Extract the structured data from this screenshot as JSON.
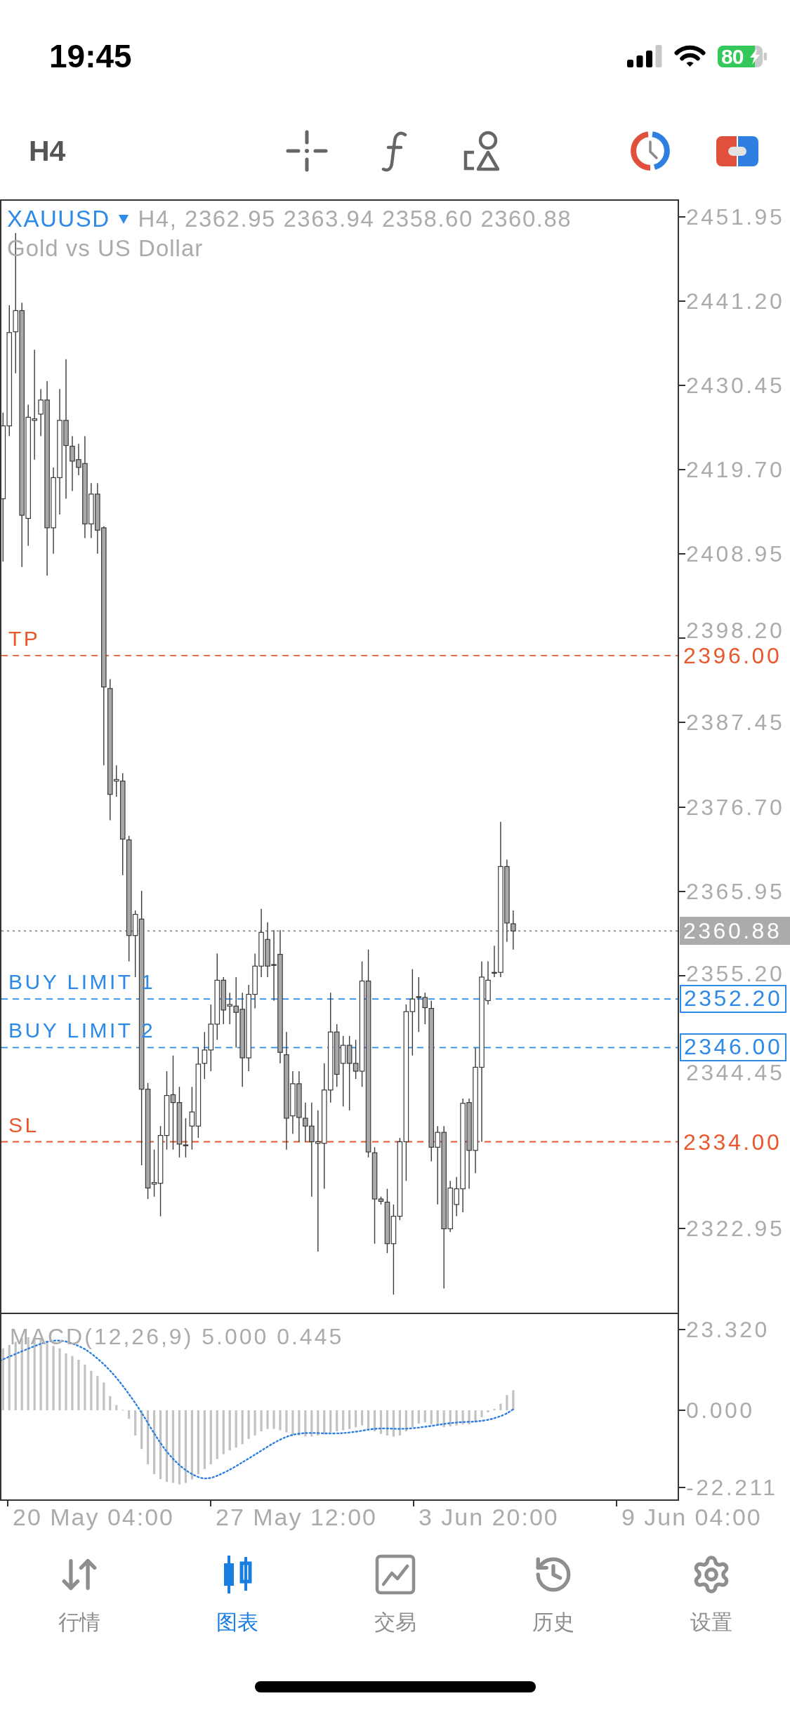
{
  "status_bar": {
    "time": "19:45",
    "battery": "80"
  },
  "toolbar": {
    "timeframe": "H4"
  },
  "chart": {
    "symbol": "XAUUSD",
    "ohlc": "H4, 2362.95 2363.94 2358.60 2360.88",
    "description": "Gold vs US Dollar",
    "price_ticks": [
      "2451.95",
      "2441.20",
      "2430.45",
      "2419.70",
      "2408.95",
      "2398.20",
      "2387.45",
      "2376.70",
      "2365.95",
      "2355.20",
      "2344.45",
      "2322.95"
    ],
    "current_price": "2360.88",
    "order_lines": [
      {
        "label": "TP",
        "price": "2396.00",
        "kind": "exit",
        "color": "#e8582c"
      },
      {
        "label": "BUY LIMIT 1",
        "price": "2352.20",
        "kind": "pending",
        "color": "#2d8ae6"
      },
      {
        "label": "BUY LIMIT 2",
        "price": "2346.00",
        "kind": "pending",
        "color": "#2d8ae6"
      },
      {
        "label": "SL",
        "price": "2334.00",
        "kind": "exit",
        "color": "#e8582c"
      }
    ]
  },
  "indicator": {
    "title": "MACD(12,26,9) 5.000 0.445",
    "ticks": [
      "23.320",
      "0.000",
      "-22.211"
    ]
  },
  "time_axis": [
    "20 May 04:00",
    "27 May 12:00",
    "3 Jun 20:00",
    "9 Jun 04:00"
  ],
  "tab_bar": [
    {
      "label": "行情",
      "selected": false
    },
    {
      "label": "图表",
      "selected": true
    },
    {
      "label": "交易",
      "selected": false
    },
    {
      "label": "历史",
      "selected": false
    },
    {
      "label": "设置",
      "selected": false
    }
  ]
}
